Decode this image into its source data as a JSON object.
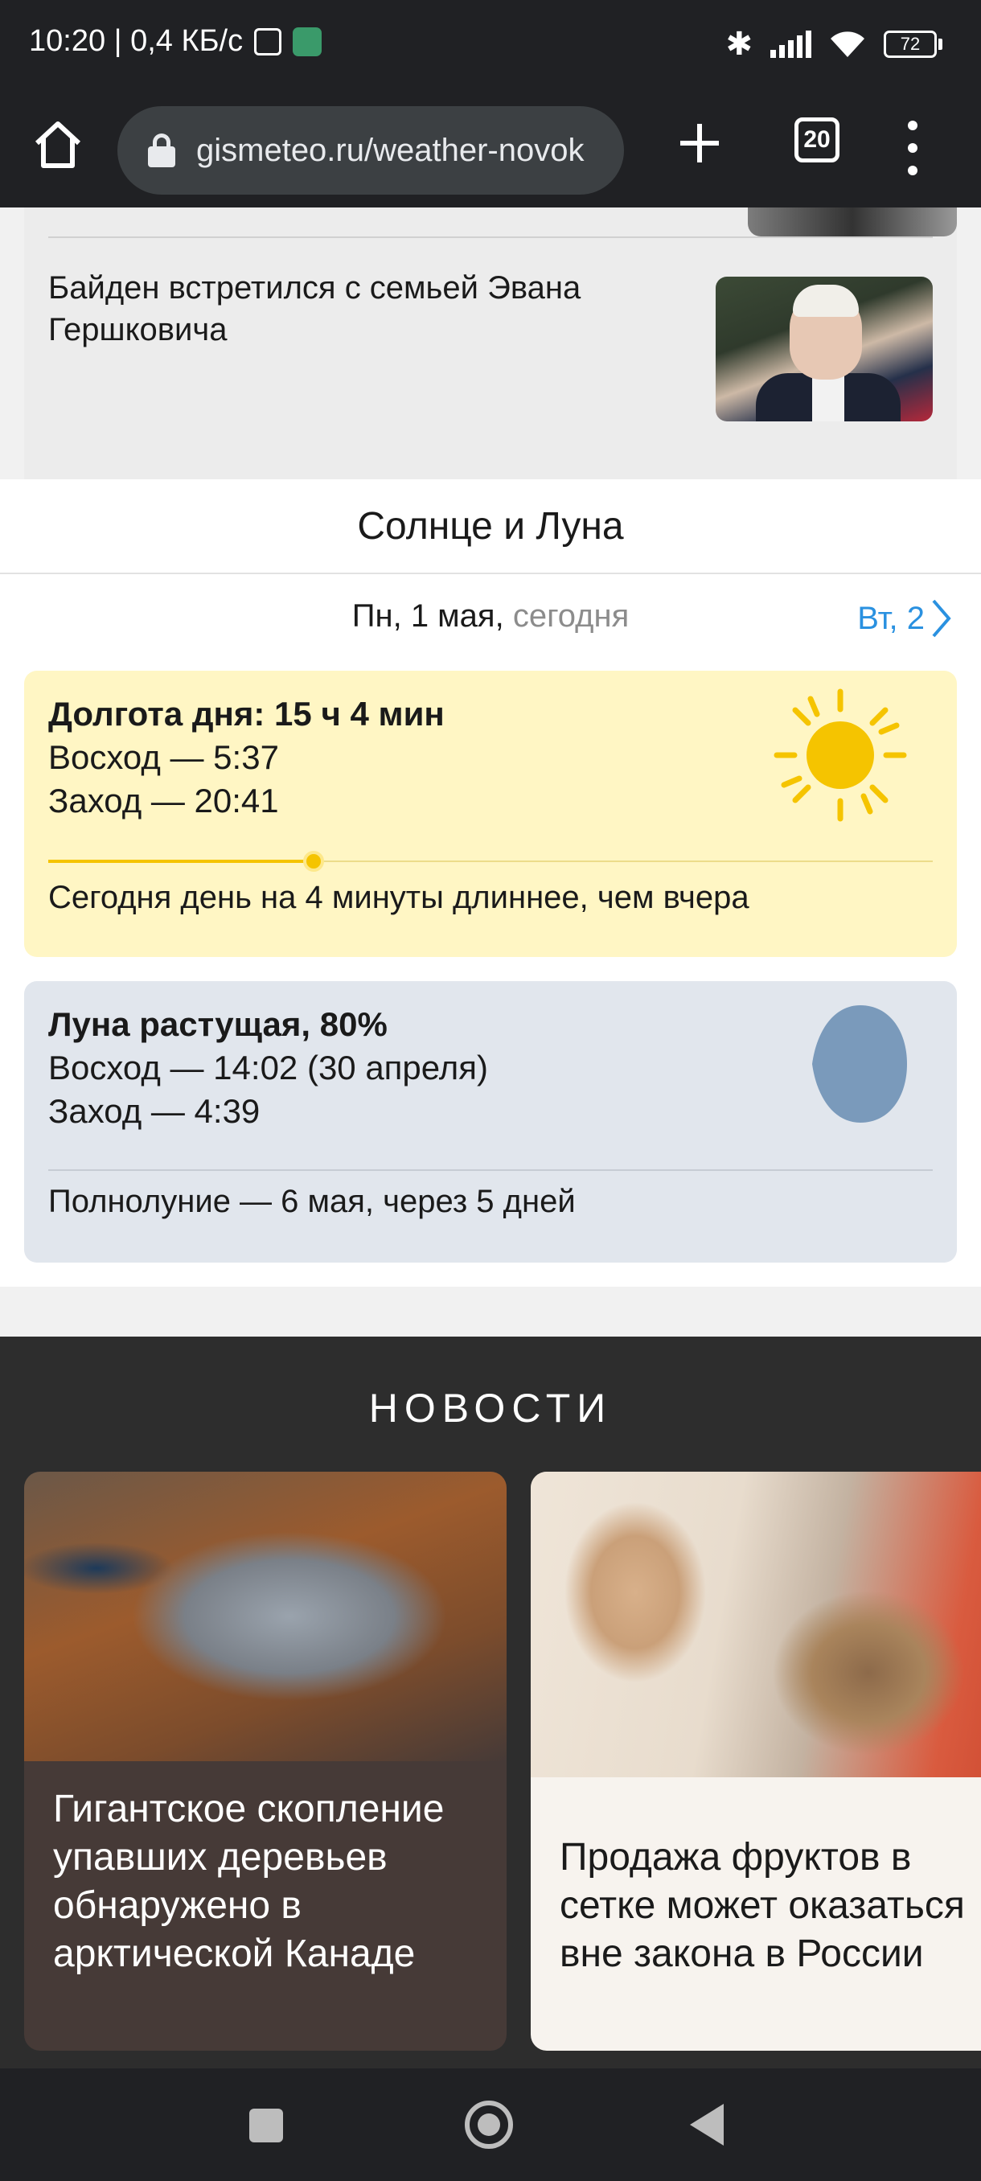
{
  "status_bar": {
    "time_speed": "10:20 | 0,4 КБ/с",
    "battery": "72",
    "icons": [
      "nfc-icon",
      "app-icon",
      "bluetooth-icon",
      "signal-icon",
      "wifi-icon",
      "battery-icon"
    ]
  },
  "browser": {
    "url": "gismeteo.ru/weather-novok",
    "tab_count": "20",
    "icons": [
      "home-icon",
      "lock-icon",
      "plus-icon",
      "tabs-icon",
      "menu-icon"
    ]
  },
  "news_top": {
    "headline": "Байден встретился с семьей Эвана Гершковича"
  },
  "sun_moon": {
    "title": "Солнце и Луна",
    "date": "Пн, 1 мая,",
    "date_suffix": "сегодня",
    "next_day": "Вт, 2",
    "sun": {
      "title": "Долгота дня: 15 ч 4 мин",
      "sunrise": "Восход — 5:37",
      "sunset": "Заход — 20:41",
      "progress": 0.3,
      "note": "Сегодня день на 4 минуты длиннее, чем вчера",
      "color": "#f5c400"
    },
    "moon": {
      "title": "Луна растущая, 80%",
      "moonrise": "Восход — 14:02 (30 апреля)",
      "moonset": "Заход — 4:39",
      "note": "Полнолуние — 6 мая, через 5 дней",
      "color": "#7a9abb"
    }
  },
  "news": {
    "heading": "НОВОСТИ",
    "items": [
      {
        "title": "Гигантское скопление упавших деревьев обнаружено в арктической Канаде"
      },
      {
        "title": "Продажа фруктов в сетке может оказаться вне закона в России"
      }
    ]
  },
  "nav": {
    "icons": [
      "recents-icon",
      "home-nav-icon",
      "back-icon"
    ]
  }
}
